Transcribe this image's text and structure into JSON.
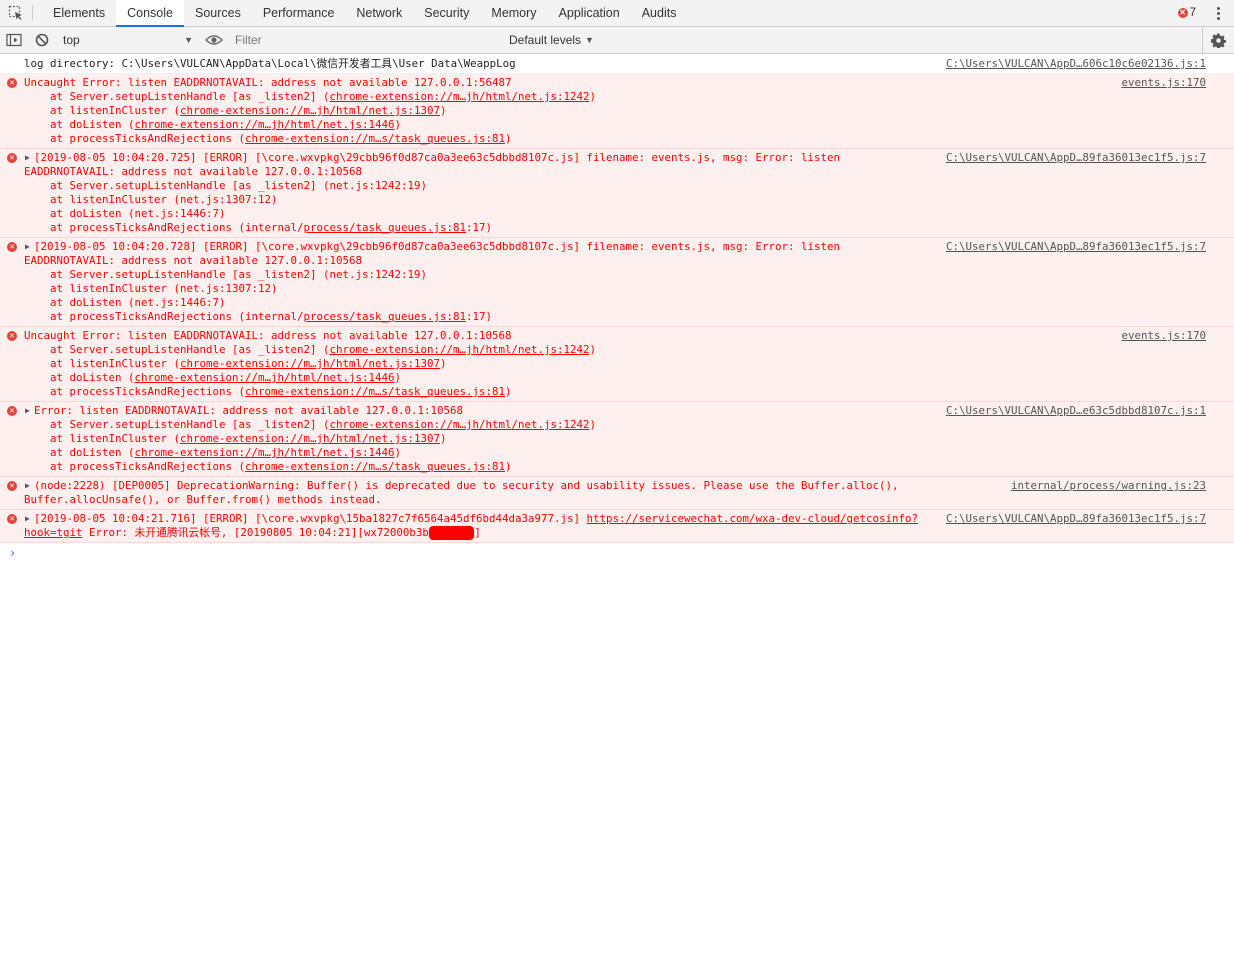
{
  "tabs": [
    {
      "label": "Elements"
    },
    {
      "label": "Console"
    },
    {
      "label": "Sources"
    },
    {
      "label": "Performance"
    },
    {
      "label": "Network"
    },
    {
      "label": "Security"
    },
    {
      "label": "Memory"
    },
    {
      "label": "Application"
    },
    {
      "label": "Audits"
    }
  ],
  "active_tab": "Console",
  "error_count": "7",
  "toolbar": {
    "context": "top",
    "filter_placeholder": "Filter",
    "levels": "Default levels"
  },
  "colors": {
    "error_text": "#ff0000",
    "error_bg": "#fff0f0",
    "accent": "#1a73e8"
  },
  "messages": [
    {
      "type": "log",
      "text": "log directory: C:\\Users\\VULCAN\\AppData\\Local\\微信开发者工具\\User Data\\WeappLog",
      "source": "C:\\Users\\VULCAN\\AppD…606c10c6e02136.js:1"
    },
    {
      "type": "error",
      "text": "Uncaught Error: listen EADDRNOTAVAIL: address not available 127.0.0.1:56487",
      "source": "events.js:170",
      "frames": [
        {
          "fn": "at Server.setupListenHandle [as _listen2] (",
          "link": "chrome-extension://m…jh/html/net.js:1242",
          "end": ")"
        },
        {
          "fn": "at listenInCluster (",
          "link": "chrome-extension://m…jh/html/net.js:1307",
          "end": ")"
        },
        {
          "fn": "at doListen (",
          "link": "chrome-extension://m…jh/html/net.js:1446",
          "end": ")"
        },
        {
          "fn": "at processTicksAndRejections (",
          "link": "chrome-extension://m…s/task_queues.js:81",
          "end": ")"
        }
      ]
    },
    {
      "type": "error",
      "text": "[2019-08-05 10:04:20.725] [ERROR] [\\core.wxvpkg\\29cbb96f0d87ca0a3ee63c5dbbd8107c.js] filename: events.js, msg: Error: listen",
      "text2": "EADDRNOTAVAIL: address not available 127.0.0.1:10568",
      "source": "C:\\Users\\VULCAN\\AppD…89fa36013ec1f5.js:7",
      "frames": [
        {
          "fn": "at Server.setupListenHandle [as _listen2] (net.js:1242:19)"
        },
        {
          "fn": "at listenInCluster (net.js:1307:12)"
        },
        {
          "fn": "at doListen (net.js:1446:7)"
        },
        {
          "fn": "at processTicksAndRejections (internal/",
          "link": "process/task_queues.js:81",
          "end": ":17)"
        }
      ]
    },
    {
      "type": "error",
      "text": "[2019-08-05 10:04:20.728] [ERROR] [\\core.wxvpkg\\29cbb96f0d87ca0a3ee63c5dbbd8107c.js] filename: events.js, msg: Error: listen",
      "text2": "EADDRNOTAVAIL: address not available 127.0.0.1:10568",
      "source": "C:\\Users\\VULCAN\\AppD…89fa36013ec1f5.js:7",
      "frames": [
        {
          "fn": "at Server.setupListenHandle [as _listen2] (net.js:1242:19)"
        },
        {
          "fn": "at listenInCluster (net.js:1307:12)"
        },
        {
          "fn": "at doListen (net.js:1446:7)"
        },
        {
          "fn": "at processTicksAndRejections (internal/",
          "link": "process/task_queues.js:81",
          "end": ":17)"
        }
      ]
    },
    {
      "type": "error",
      "text": "Uncaught Error: listen EADDRNOTAVAIL: address not available 127.0.0.1:10568",
      "source": "events.js:170",
      "frames": [
        {
          "fn": "at Server.setupListenHandle [as _listen2] (",
          "link": "chrome-extension://m…jh/html/net.js:1242",
          "end": ")"
        },
        {
          "fn": "at listenInCluster (",
          "link": "chrome-extension://m…jh/html/net.js:1307",
          "end": ")"
        },
        {
          "fn": "at doListen (",
          "link": "chrome-extension://m…jh/html/net.js:1446",
          "end": ")"
        },
        {
          "fn": "at processTicksAndRejections (",
          "link": "chrome-extension://m…s/task_queues.js:81",
          "end": ")"
        }
      ]
    },
    {
      "type": "error",
      "text": "Error: listen EADDRNOTAVAIL: address not available 127.0.0.1:10568",
      "source": "C:\\Users\\VULCAN\\AppD…e63c5dbbd8107c.js:1",
      "frames": [
        {
          "fn": "at Server.setupListenHandle [as _listen2] (",
          "link": "chrome-extension://m…jh/html/net.js:1242",
          "end": ")"
        },
        {
          "fn": "at listenInCluster (",
          "link": "chrome-extension://m…jh/html/net.js:1307",
          "end": ")"
        },
        {
          "fn": "at doListen (",
          "link": "chrome-extension://m…jh/html/net.js:1446",
          "end": ")"
        },
        {
          "fn": "at processTicksAndRejections (",
          "link": "chrome-extension://m…s/task_queues.js:81",
          "end": ")"
        }
      ]
    },
    {
      "type": "error",
      "text": "(node:2228) [DEP0005] DeprecationWarning: Buffer() is deprecated due to security and usability issues. Please use the Buffer.alloc(),",
      "text2": "Buffer.allocUnsafe(), or Buffer.from() methods instead.",
      "source": "internal/process/warning.js:23"
    },
    {
      "type": "error",
      "text": "[2019-08-05 10:04:21.716] [ERROR] [\\core.wxvpkg\\15ba1827c7f6564a45df6bd44da3a977.js] ",
      "url": "https://servicewechat.com/wxa-dev-cloud/getcosinfo?",
      "url2": "hook=tgit",
      "text2": " Error: 未开通腾讯云帐号, [20190805 10:04:21][wx72000b3b",
      "redacted": "xxxxxxx",
      "text3": "]",
      "source": "C:\\Users\\VULCAN\\AppD…89fa36013ec1f5.js:7"
    }
  ]
}
